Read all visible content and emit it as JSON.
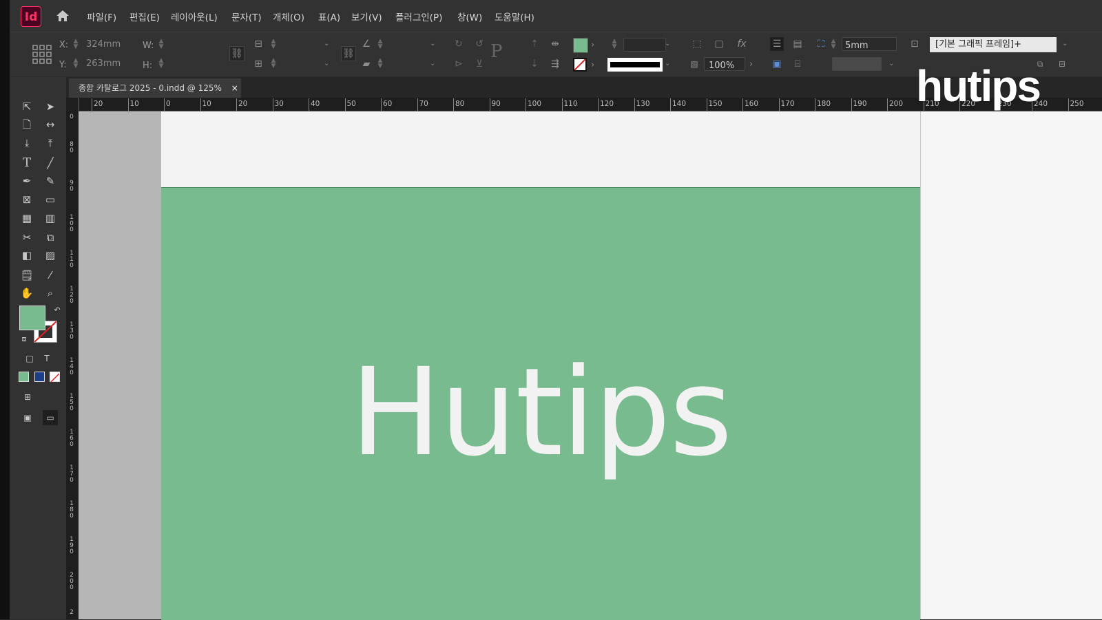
{
  "app": {
    "logo_text": "Id",
    "brand_color": "#ff3366"
  },
  "menu": [
    "파일(F)",
    "편집(E)",
    "레이아웃(L)",
    "문자(T)",
    "개체(O)",
    "표(A)",
    "보기(V)",
    "플러그인(P)",
    "창(W)",
    "도움말(H)"
  ],
  "control": {
    "x_label": "X:",
    "x_value": "324mm",
    "y_label": "Y:",
    "y_value": "263mm",
    "w_label": "W:",
    "h_label": "H:",
    "opacity": "100%",
    "spacing": "5mm",
    "frame_style": "[기본 그래픽 프레임]+",
    "fill_color": "#78bb8f"
  },
  "document_tab": {
    "title": "종합 카탈로그 2025 - 0.indd @ 125%",
    "close": "×"
  },
  "ruler": {
    "h_ticks": [
      "20",
      "10",
      "0",
      "10",
      "20",
      "30",
      "40",
      "50",
      "60",
      "70",
      "80",
      "90",
      "100",
      "110",
      "120",
      "130",
      "140",
      "150",
      "160",
      "170",
      "180",
      "190",
      "200",
      "210",
      "220",
      "230",
      "240",
      "250"
    ],
    "v_ticks": [
      "0",
      "8 0",
      "9 0",
      "1 0 0",
      "1 1 0",
      "1 2 0",
      "1 3 0",
      "1 4 0",
      "1 5 0",
      "1 6 0",
      "1 7 0",
      "1 8 0",
      "1 9 0",
      "2 0 0",
      "2"
    ]
  },
  "canvas": {
    "headline": "Hutips",
    "frame_color": "#78bb8f"
  },
  "watermark": "hutips"
}
